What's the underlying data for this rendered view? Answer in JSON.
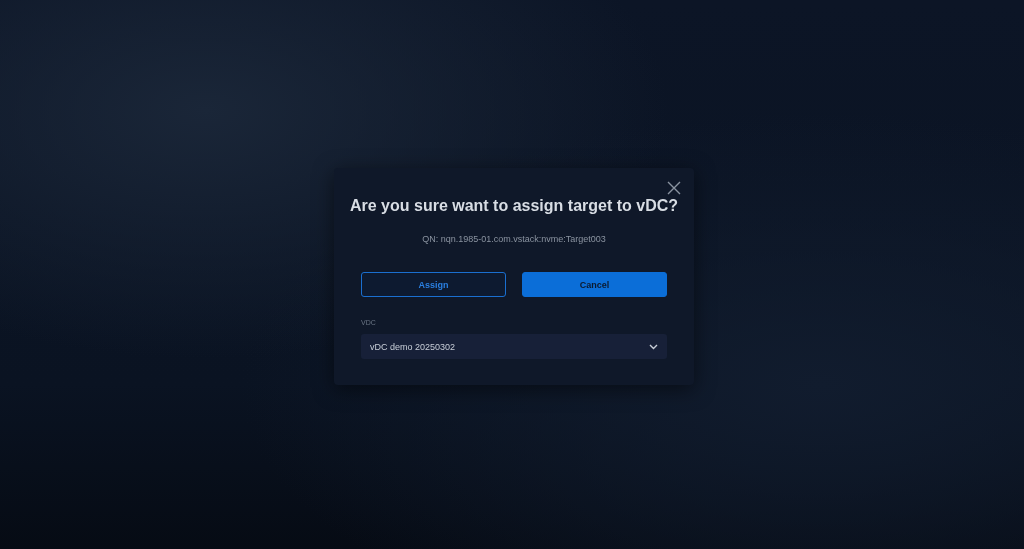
{
  "dialog": {
    "title": "Are you sure want to assign target to vDC?",
    "subtitle": "QN: nqn.1985-01.com.vstack:nvme:Target003",
    "buttons": [
      {
        "label": "Assign",
        "kind": "outline"
      },
      {
        "label": "Cancel",
        "kind": "filled"
      }
    ],
    "field": {
      "label": "VDC",
      "value": "vDC demo 20250302"
    }
  }
}
